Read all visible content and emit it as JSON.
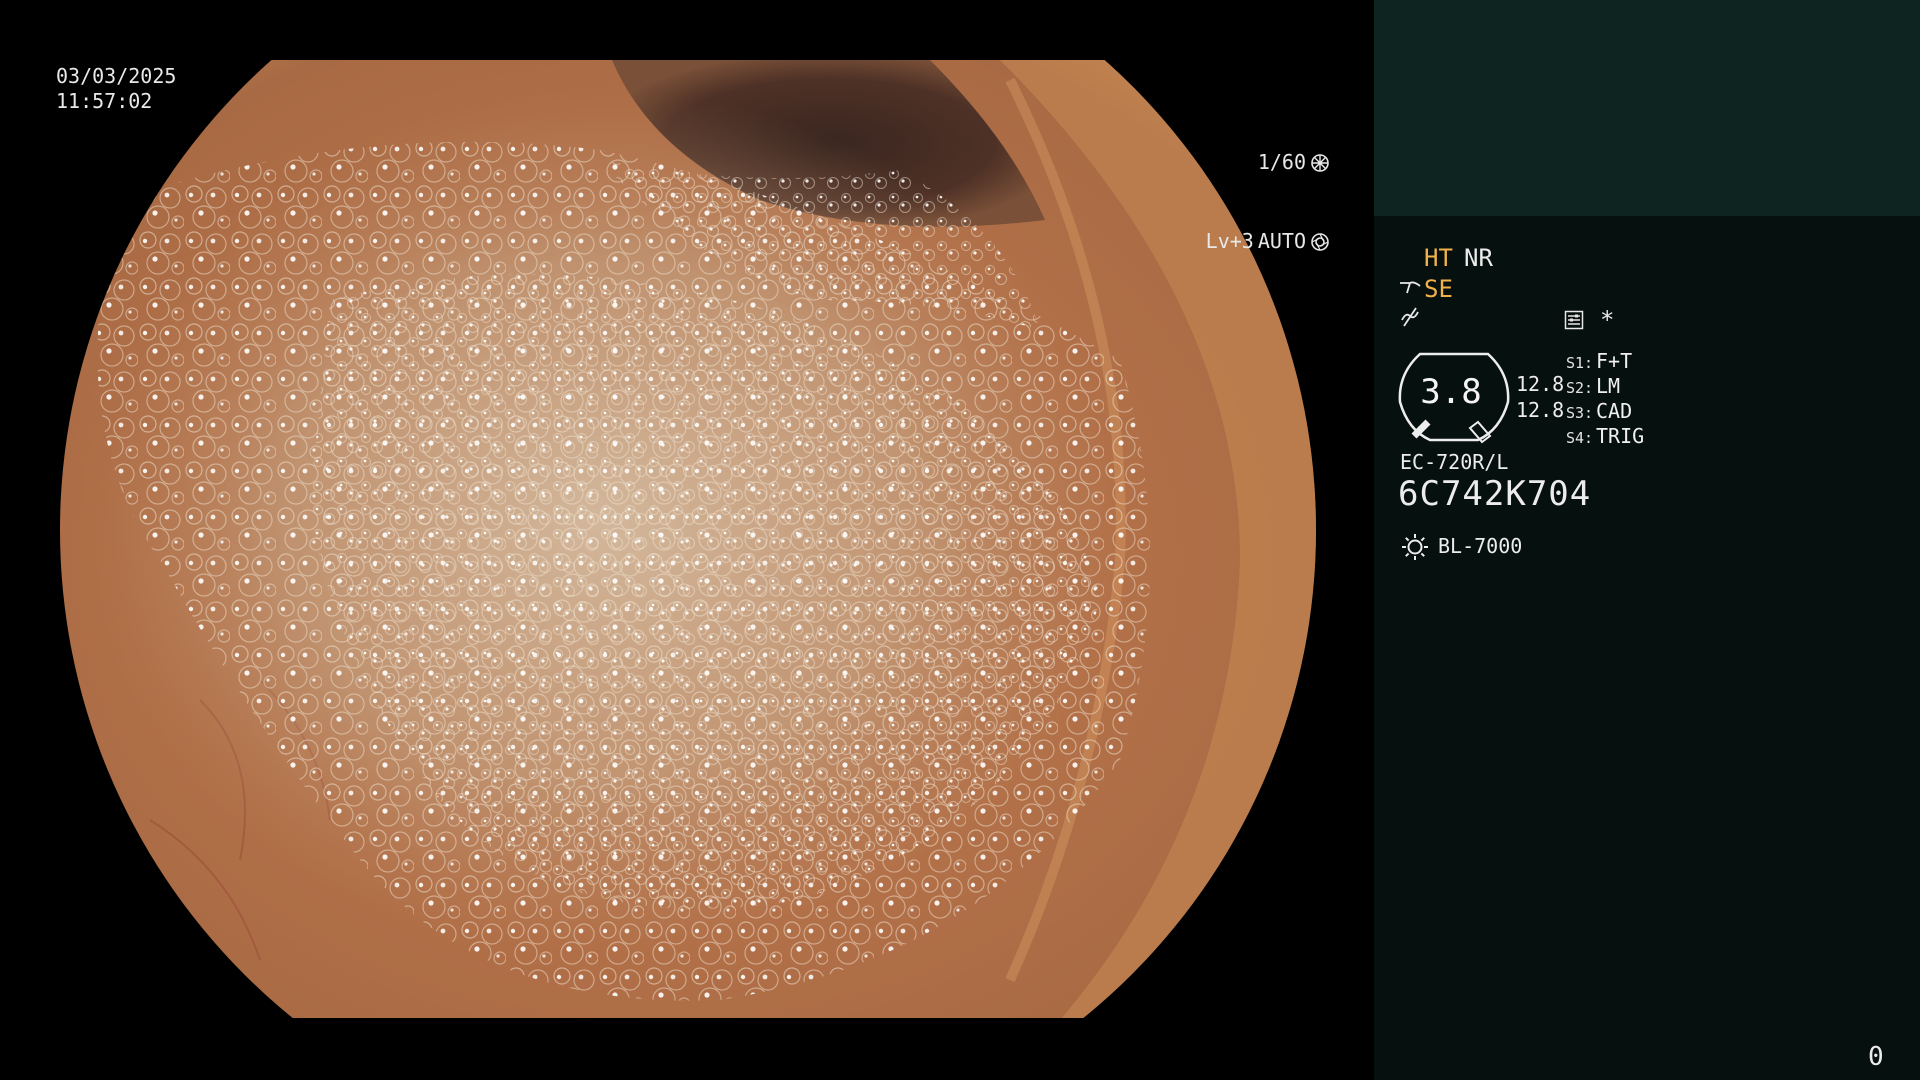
{
  "overlay": {
    "date": "03/03/2025",
    "time": "11:57:02",
    "shutter": "1/60",
    "level": "Lv+3",
    "mode": "AUTO"
  },
  "panel": {
    "ht": "HT",
    "nr": "NR",
    "se": "SE",
    "star": "*",
    "dial_value": "3.8",
    "value_a": "12.8",
    "value_b": "12.8",
    "switches": [
      {
        "key": "S1:",
        "value": "F+T"
      },
      {
        "key": "S2:",
        "value": "LM"
      },
      {
        "key": "S3:",
        "value": "CAD"
      },
      {
        "key": "S4:",
        "value": "TRIG"
      }
    ],
    "scope_model": "EC-720R/L",
    "scope_serial": "6C742K704",
    "light_source": "BL-7000",
    "counter": "0"
  },
  "colors": {
    "panel_background": "#06100e",
    "panel_top": "#0e2420",
    "highlight": "#f2b24a",
    "tissue": "#b7784e"
  }
}
